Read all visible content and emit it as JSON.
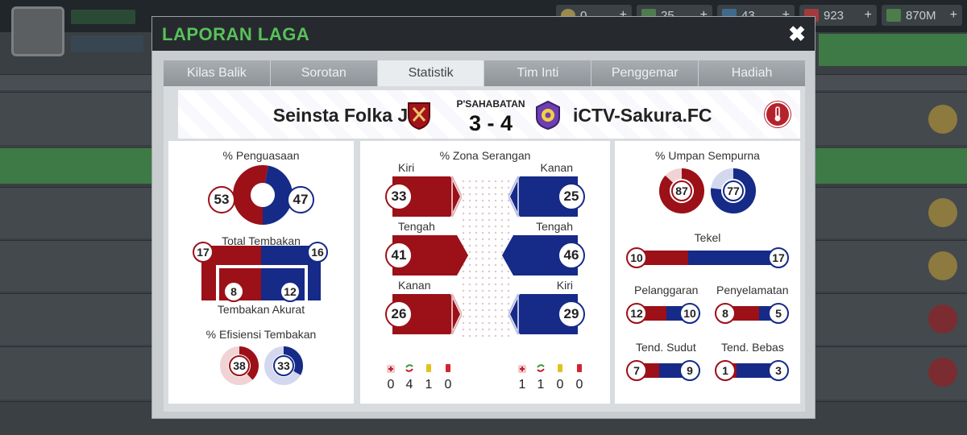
{
  "background": {
    "currencies": [
      {
        "value": "0",
        "plus": "+",
        "icon": "coin-icon"
      },
      {
        "value": "25",
        "plus": "+",
        "icon": "cash-icon"
      },
      {
        "value": "43",
        "plus": "+",
        "icon": "energy-icon"
      },
      {
        "value": "923",
        "plus": "+",
        "icon": "flag-icon"
      },
      {
        "value": "870M",
        "plus": "+",
        "icon": "money-icon"
      }
    ]
  },
  "modal": {
    "title": "LAPORAN LAGA",
    "close_label": "✖",
    "tabs": [
      {
        "label": "Kilas Balik",
        "active": false
      },
      {
        "label": "Sorotan",
        "active": false
      },
      {
        "label": "Statistik",
        "active": true
      },
      {
        "label": "Tim Inti",
        "active": false
      },
      {
        "label": "Penggemar",
        "active": false
      },
      {
        "label": "Hadiah",
        "active": false
      }
    ],
    "match": {
      "home_team": "Seinsta Folka Jk",
      "away_team": "iCTV-Sakura.FC",
      "competition": "P'SAHABATAN",
      "score": "3 - 4"
    }
  },
  "stats": {
    "possession": {
      "title": "% Penguasaan",
      "home": "53",
      "away": "47",
      "home_pct": 53
    },
    "shots": {
      "title": "Total Tembakan",
      "home": "17",
      "away": "16",
      "on_target_label": "Tembakan Akurat",
      "on_target_home": "8",
      "on_target_away": "12"
    },
    "efficiency": {
      "title": "% Efisiensi Tembakan",
      "home": "38",
      "away": "33",
      "home_pct": 38,
      "away_pct": 33
    },
    "attack_zones": {
      "title": "% Zona Serangan",
      "rows": [
        {
          "home_label": "Kiri",
          "home": "33",
          "away_label": "Kanan",
          "away": "25"
        },
        {
          "home_label": "Tengah",
          "home": "41",
          "away_label": "Tengah",
          "away": "46"
        },
        {
          "home_label": "Kanan",
          "home": "26",
          "away_label": "Kiri",
          "away": "29"
        }
      ]
    },
    "discipline": {
      "home": [
        "0",
        "4",
        "1",
        "0"
      ],
      "away": [
        "1",
        "1",
        "0",
        "0"
      ],
      "icons": [
        "injury-icon",
        "substitution-icon",
        "yellow-card-icon",
        "red-card-icon"
      ]
    },
    "passes": {
      "title": "% Umpan Sempurna",
      "home": "87",
      "away": "77",
      "home_pct": 87,
      "away_pct": 77
    },
    "tackles": {
      "title": "Tekel",
      "home": "10",
      "away": "17"
    },
    "fouls": {
      "title": "Pelanggaran",
      "home": "12",
      "away": "10"
    },
    "saves": {
      "title": "Penyelamatan",
      "home": "8",
      "away": "5"
    },
    "corners": {
      "title": "Tend. Sudut",
      "home": "7",
      "away": "9"
    },
    "free_kicks": {
      "title": "Tend. Bebas",
      "home": "1",
      "away": "3"
    },
    "colors": {
      "home": "#9c1018",
      "away": "#162a88"
    }
  }
}
